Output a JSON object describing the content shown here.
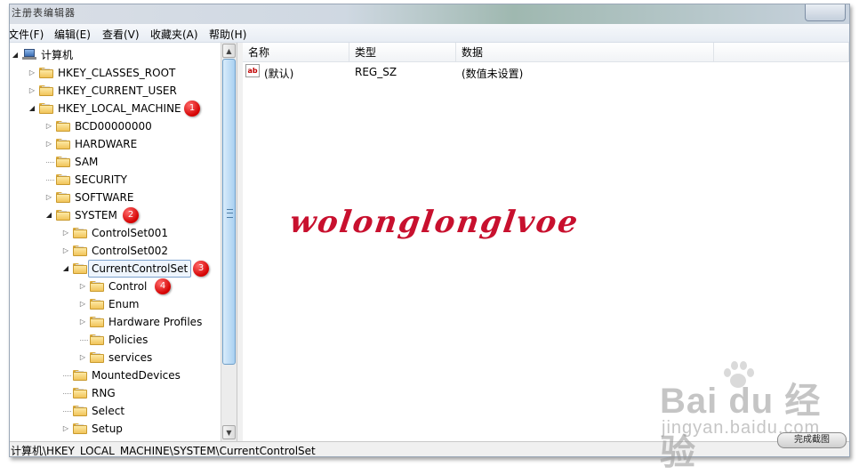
{
  "window": {
    "title": "注册表编辑器"
  },
  "menu": [
    "文件(F)",
    "编辑(E)",
    "查看(V)",
    "收藏夹(A)",
    "帮助(H)"
  ],
  "tree": {
    "root": "计算机",
    "nodes": [
      {
        "label": "HKEY_CLASSES_ROOT",
        "marker": ""
      },
      {
        "label": "HKEY_CURRENT_USER",
        "marker": ""
      },
      {
        "label": "HKEY_LOCAL_MACHINE",
        "marker": "1"
      },
      {
        "label": "BCD00000000",
        "marker": ""
      },
      {
        "label": "HARDWARE",
        "marker": ""
      },
      {
        "label": "SAM",
        "marker": ""
      },
      {
        "label": "SECURITY",
        "marker": ""
      },
      {
        "label": "SOFTWARE",
        "marker": ""
      },
      {
        "label": "SYSTEM",
        "marker": "2"
      },
      {
        "label": "ControlSet001",
        "marker": ""
      },
      {
        "label": "ControlSet002",
        "marker": ""
      },
      {
        "label": "CurrentControlSet",
        "marker": "3",
        "selected": true
      },
      {
        "label": "Control",
        "marker": "4"
      },
      {
        "label": "Enum",
        "marker": ""
      },
      {
        "label": "Hardware Profiles",
        "marker": ""
      },
      {
        "label": "Policies",
        "marker": ""
      },
      {
        "label": "services",
        "marker": ""
      },
      {
        "label": "MountedDevices",
        "marker": ""
      },
      {
        "label": "RNG",
        "marker": ""
      },
      {
        "label": "Select",
        "marker": ""
      },
      {
        "label": "Setup",
        "marker": ""
      }
    ]
  },
  "list": {
    "headers": [
      "名称",
      "类型",
      "数据"
    ],
    "rows": [
      {
        "name": "(默认)",
        "type": "REG_SZ",
        "data": "(数值未设置)",
        "icon": "ab"
      }
    ]
  },
  "watermark": "wolonglonglvoe",
  "status": {
    "path": "计算机\\HKEY_LOCAL_MACHINE\\SYSTEM\\CurrentControlSet"
  },
  "baidu": {
    "logo": "Bai du 经验",
    "url": "jingyan.baidu.com"
  },
  "capture_button": "完成截图",
  "colors": {
    "marker": "#d40000",
    "watermark": "#c8102e",
    "selection": "#7da2ce"
  }
}
